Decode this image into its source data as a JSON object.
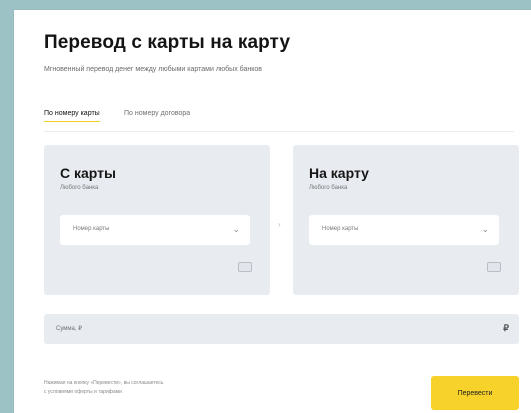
{
  "page": {
    "title": "Перевод с карты на карту",
    "subtitle": "Мгновенный перевод денег между любыми картами любых банков"
  },
  "tabs": [
    {
      "label": "По номеру карты",
      "active": true
    },
    {
      "label": "По номеру договора",
      "active": false
    }
  ],
  "from_panel": {
    "title": "С карты",
    "label": "Любого банка",
    "input_placeholder": "Номер карты",
    "chevron_icon": "chevron-down-icon",
    "cvc_icon": "card-chip-icon"
  },
  "arrow_icon": "arrow-right-icon",
  "to_panel": {
    "title": "На карту",
    "label": "Любого банка",
    "input_placeholder": "Номер карты",
    "chevron_icon": "chevron-down-icon",
    "cvc_icon": "card-chip-icon"
  },
  "amount": {
    "placeholder": "Сумма, ₽",
    "currency_symbol": "₽"
  },
  "footer": {
    "note_line1": "Нажимая на кнопку «Перевести», вы соглашаетесь",
    "note_line2": "с условиями оферты и тарифами",
    "submit_label": "Перевести"
  },
  "colors": {
    "accent": "#f7d22b",
    "panel_bg": "#e8ebf0",
    "page_bg": "#9cc2c6"
  }
}
